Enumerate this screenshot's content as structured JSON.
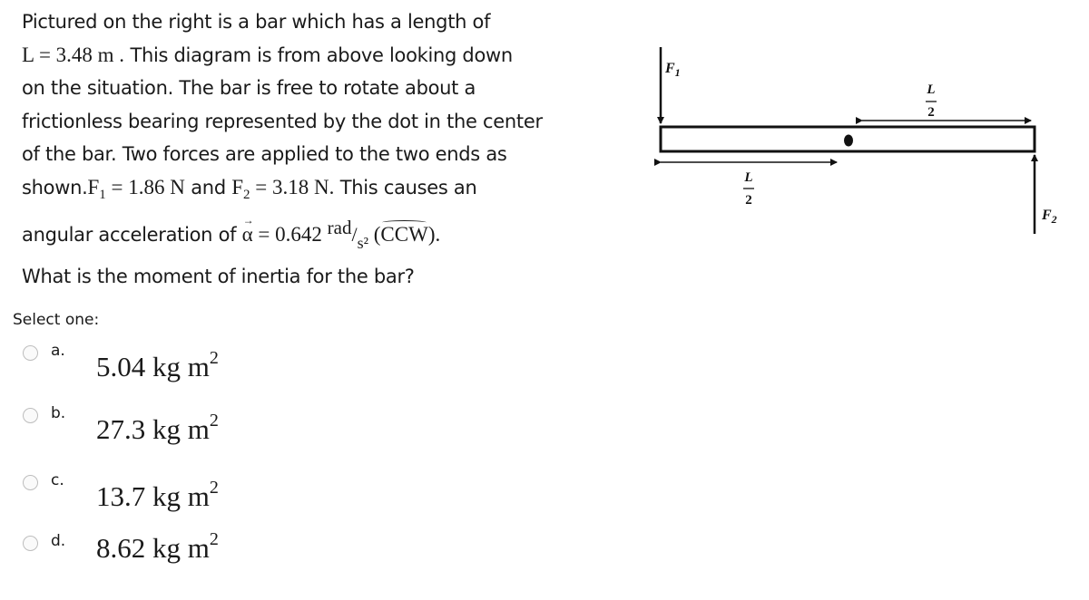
{
  "question": {
    "line1": "Pictured on the right is a bar which has a length of",
    "line2_math": "L = 3.48 m .",
    "line2_text": " This diagram is from above looking down",
    "line3": "on the situation.  The bar is free to rotate about a",
    "line4": "frictionless bearing represented by the dot in the center",
    "line5": "of the bar.  Two forces are applied to the two ends as",
    "line6_prefix": "shown.",
    "f1_symbol": "F",
    "f1_sub": "1",
    "f1_value": " = 1.86 N",
    "line6_and": " and ",
    "f2_symbol": "F",
    "f2_sub": "2",
    "f2_value": " = 3.18 N.",
    "line6_suffix": "  This causes an",
    "line7_prefix": "angular acceleration of ",
    "alpha_symbol": "α",
    "alpha_arrow": "→",
    "alpha_value": " = 0.642 ",
    "unit_num": "rad",
    "unit_slash": "/",
    "unit_den": "s²",
    "direction_open": " (",
    "direction": "CCW",
    "direction_close": ").",
    "line8": "What is the moment of inertia for the bar?"
  },
  "select_label": "Select one:",
  "options": [
    {
      "letter": "a.",
      "value": "5.04 kg m",
      "exp": "2",
      "selected": false
    },
    {
      "letter": "b.",
      "value": "27.3 kg m",
      "exp": "2",
      "selected": false
    },
    {
      "letter": "c.",
      "value": "13.7 kg m",
      "exp": "2",
      "selected": false
    },
    {
      "letter": "d.",
      "value": "8.62 kg m",
      "exp": "2",
      "selected": false
    }
  ],
  "diagram": {
    "force1_label": "F",
    "force1_sub": "1",
    "force2_label": "F",
    "force2_sub": "2",
    "half_length_num": "L",
    "half_length_den": "2"
  }
}
